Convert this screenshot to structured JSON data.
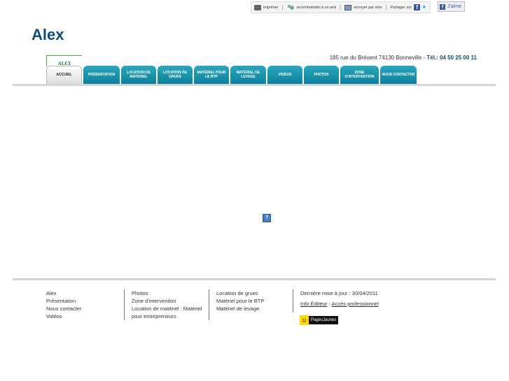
{
  "share": {
    "print": "imprimer",
    "recommend": "recommander à un ami",
    "email": "envoyer par sms",
    "share_on": "Partager sur",
    "like": "J'aime"
  },
  "site": {
    "title": "Alex",
    "logo_text": "ALEX"
  },
  "contact": {
    "address": "185 rue du Brévent 74130 Bonneville",
    "tel": "Tél.: 04 50 25 00 11"
  },
  "nav": {
    "tabs": [
      {
        "label": "ACCUEIL"
      },
      {
        "label": "PRÉSENTATION"
      },
      {
        "label": "LOCATION DE MATÉRIEL"
      },
      {
        "label": "LOCATION DE GRUES"
      },
      {
        "label": "MATÉRIEL POUR LE BTP"
      },
      {
        "label": "MATÉRIEL DE LEVAGE"
      },
      {
        "label": "VIDÉOS"
      },
      {
        "label": "PHOTOS"
      },
      {
        "label": "ZONE D'INTERVENTION"
      },
      {
        "label": "NOUS CONTACTER"
      }
    ]
  },
  "broken_image": "?",
  "footer": {
    "col1": [
      "Alex",
      "Présentation",
      "Nous contacter",
      "Vidéos"
    ],
    "col2": [
      "Photos",
      "Zone d'intervention",
      "Location de matériel : Matériel pour entrepreneurs"
    ],
    "col3": [
      "Location de grues",
      "Matériel pour le BTP",
      "Matériel de levage"
    ],
    "last_update": "Dernière mise à jour : 30/04/2011",
    "info_editeur": "Info Éditeur",
    "sep": " - ",
    "acces_pro": "Accès professionnel",
    "pj_label": "PagesJaunes"
  }
}
